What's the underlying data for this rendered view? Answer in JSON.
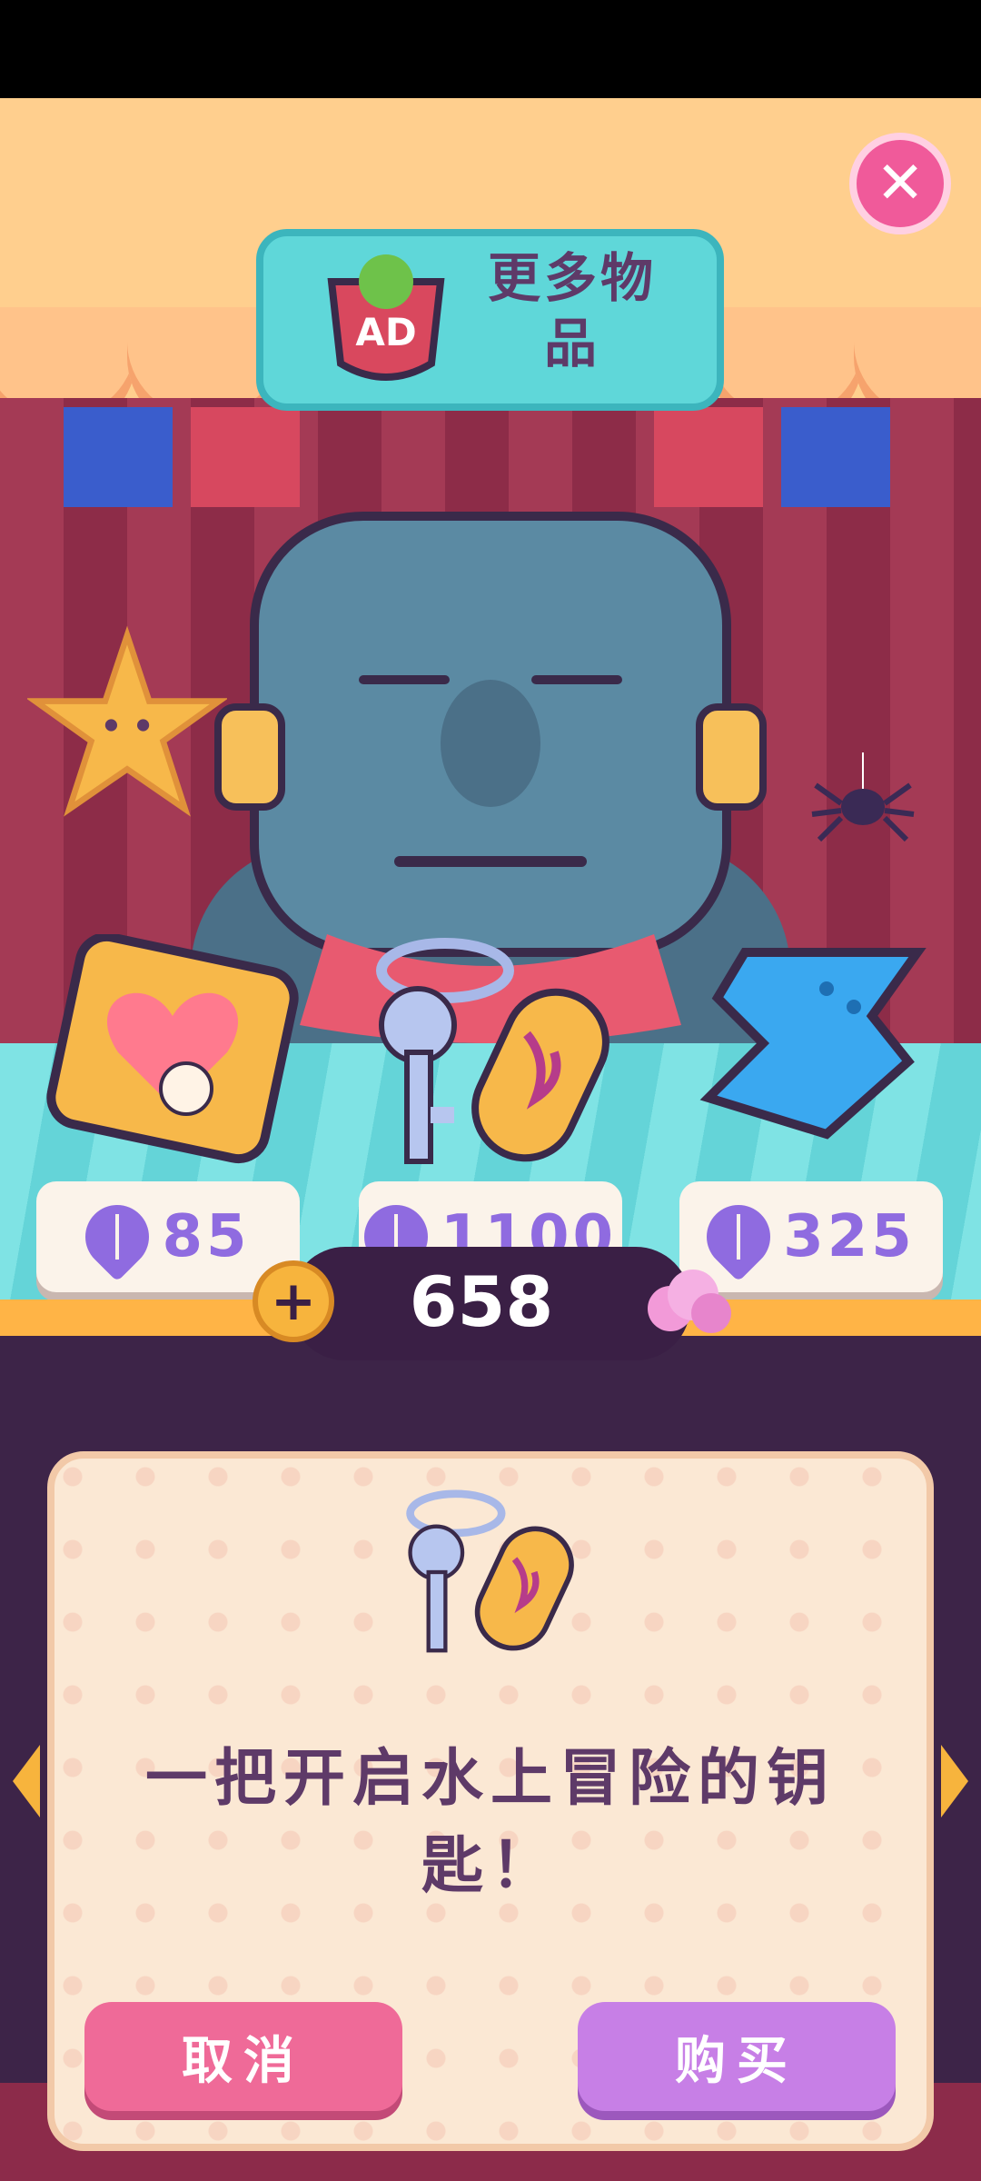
{
  "header": {
    "ad_badge": "AD",
    "more_items_label": "更多物品"
  },
  "shop_items": [
    {
      "name": "marshmallow-bag",
      "price": "85"
    },
    {
      "name": "key-with-tag",
      "price": "1100"
    },
    {
      "name": "blue-flag",
      "price": "325"
    }
  ],
  "currency": {
    "amount": "658",
    "icon": "pink-cloud-icon"
  },
  "dialog": {
    "description": "一把开启水上冒险的钥匙！",
    "cancel_label": "取消",
    "buy_label": "购买"
  },
  "colors": {
    "cancel": "#ef6a98",
    "buy": "#c77fe6",
    "price_text": "#8f6be0",
    "close": "#f05a9a"
  }
}
